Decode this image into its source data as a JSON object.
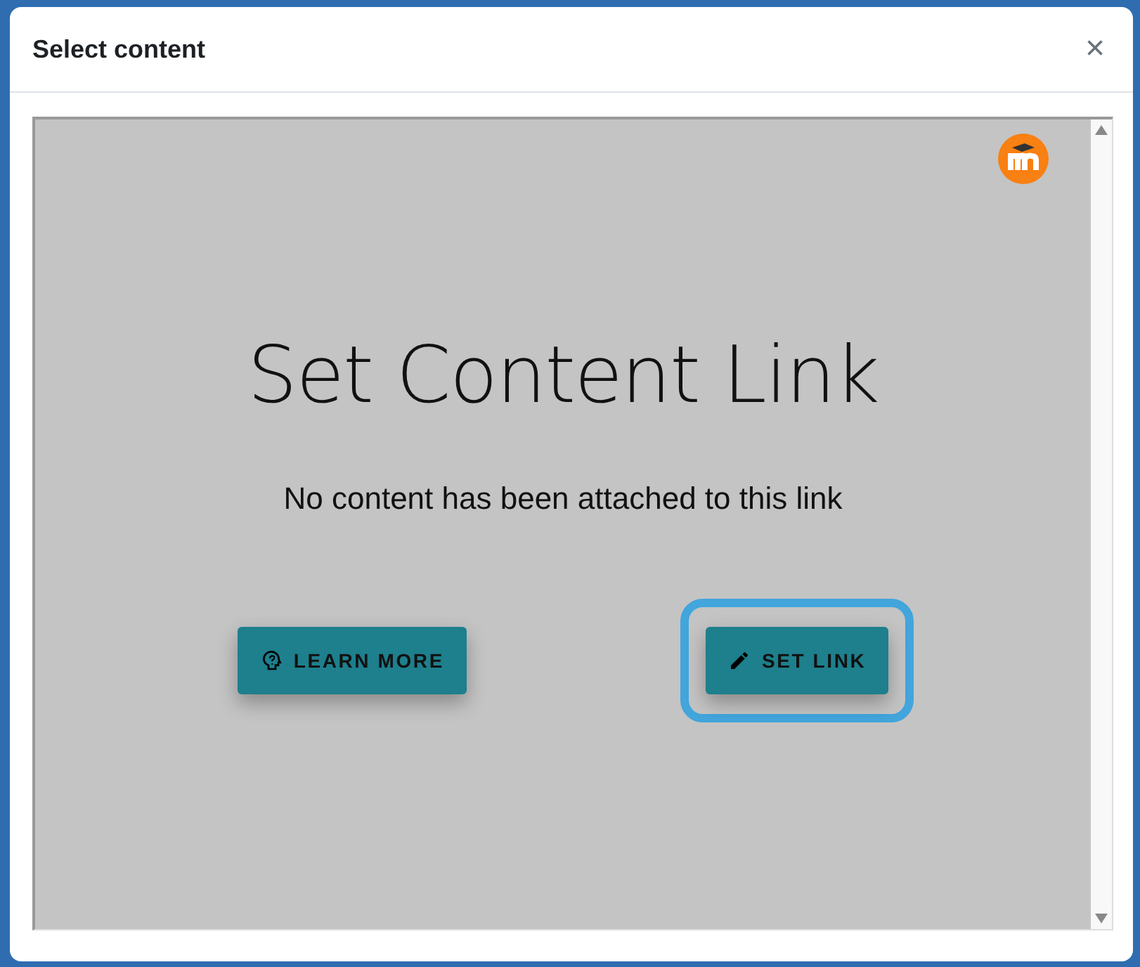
{
  "dialog": {
    "title": "Select content",
    "close": "×"
  },
  "content": {
    "heading": "Set Content Link",
    "message": "No content has been attached to this link",
    "buttons": [
      {
        "kind": "help",
        "label": "LEARN MORE",
        "focused": false
      },
      {
        "kind": "edit",
        "label": "SET LINK",
        "focused": true
      }
    ]
  }
}
